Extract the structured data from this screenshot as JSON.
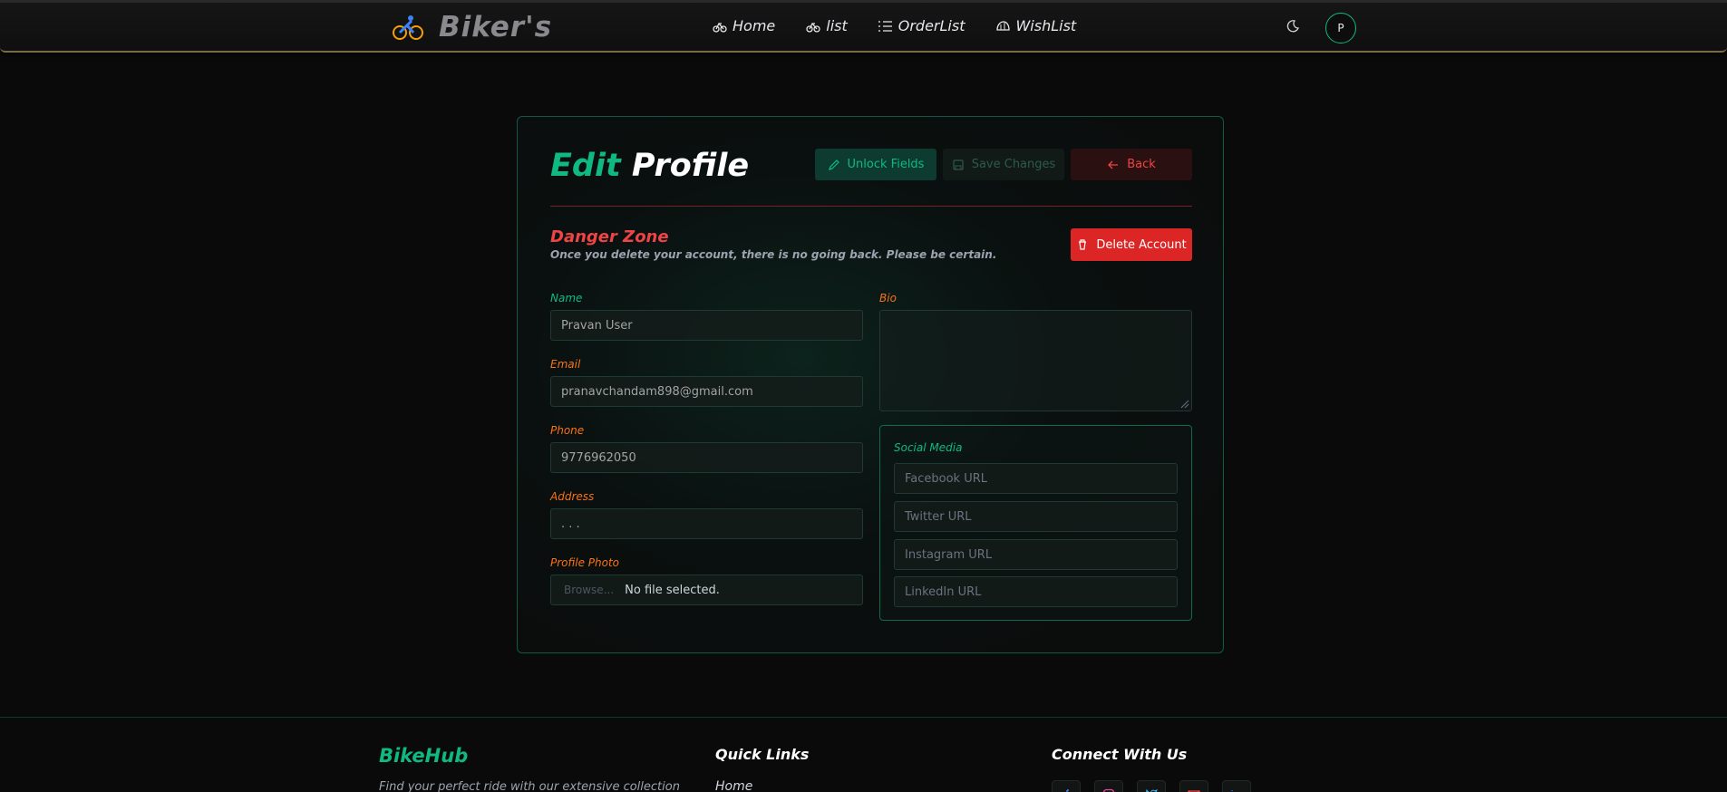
{
  "nav": {
    "brand": "Biker's",
    "links": [
      {
        "label": "Home",
        "icon": "bike-icon"
      },
      {
        "label": "list",
        "icon": "bike-icon"
      },
      {
        "label": "OrderList",
        "icon": "list-icon"
      },
      {
        "label": "WishList",
        "icon": "helmet-icon"
      }
    ],
    "avatar_initial": "P"
  },
  "edit": {
    "title_word1": "Edit",
    "title_word2": "Profile",
    "unlock_label": "Unlock Fields",
    "save_label": "Save Changes",
    "back_label": "Back"
  },
  "danger": {
    "title": "Danger Zone",
    "description": "Once you delete your account, there is no going back. Please be certain.",
    "delete_label": "Delete Account"
  },
  "form": {
    "name_label": "Name",
    "name_value": "Pravan User",
    "email_label": "Email",
    "email_value": "pranavchandam898@gmail.com",
    "phone_label": "Phone",
    "phone_value": "9776962050",
    "address_label": "Address",
    "address_value": ". . .",
    "photo_label": "Profile Photo",
    "photo_button": "Browse...",
    "photo_status": "No file selected.",
    "bio_label": "Bio",
    "bio_value": ""
  },
  "social": {
    "title": "Social Media",
    "facebook_placeholder": "Facebook URL",
    "twitter_placeholder": "Twitter URL",
    "instagram_placeholder": "Instagram URL",
    "linkedin_placeholder": "LinkedIn URL"
  },
  "footer": {
    "brand": "BikeHub",
    "description": "Find your perfect ride with our extensive collection",
    "quick_links_title": "Quick Links",
    "quick_links": [
      "Home"
    ],
    "connect_title": "Connect With Us",
    "connect_icons": [
      "facebook-icon",
      "instagram-icon",
      "twitter-icon",
      "mail-icon",
      "linkedin-icon"
    ]
  },
  "colors": {
    "accent": "#10b981",
    "danger": "#ef4444",
    "label_orange": "#f97316",
    "background": "#0a0a0b"
  }
}
